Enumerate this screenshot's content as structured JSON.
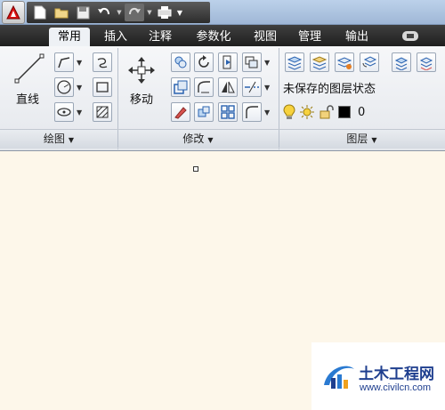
{
  "quick_access": {
    "icons": [
      "app-menu-icon",
      "new-file-icon",
      "open-file-icon",
      "save-icon",
      "undo-icon",
      "redo-icon",
      "plot-icon",
      "customize-dropdown-icon"
    ]
  },
  "tabs": [
    {
      "label": "常用",
      "active": true
    },
    {
      "label": "插入",
      "active": false
    },
    {
      "label": "注释",
      "active": false
    },
    {
      "label": "参数化",
      "active": false
    },
    {
      "label": "视图",
      "active": false
    },
    {
      "label": "管理",
      "active": false
    },
    {
      "label": "输出",
      "active": false
    }
  ],
  "panels": {
    "draw": {
      "title": "绘图",
      "line_label": "直线"
    },
    "modify": {
      "title": "修改",
      "move_label": "移动"
    },
    "layers": {
      "title": "图层",
      "layer_state": "未保存的图层状态",
      "current_layer": "0",
      "layer_color": "#000000"
    }
  },
  "watermark": {
    "title": "土木工程网",
    "url": "www.civilcn.com"
  },
  "colors": {
    "accent": "#1f3f8f",
    "canvas": "#fdf7ea",
    "tab_bar": "#2a2a2a"
  }
}
